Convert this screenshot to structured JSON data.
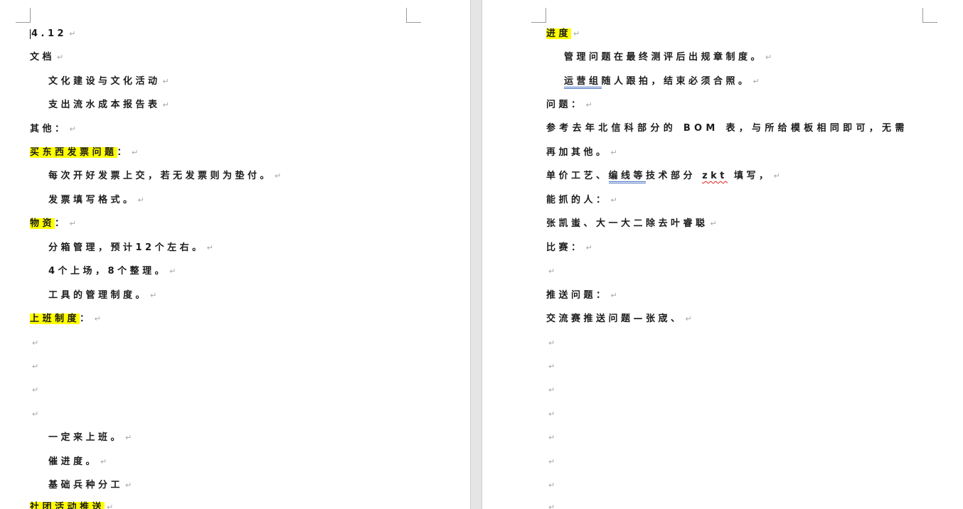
{
  "left_page": {
    "lines": [
      {
        "text": "4.12"
      },
      {
        "text": "文档"
      },
      {
        "text": "文化建设与文化活动"
      },
      {
        "text": "支出流水成本报告表"
      },
      {
        "text": "其他："
      },
      {
        "text": "买东西发票问题",
        "suffix": "："
      },
      {
        "text": "每次开好发票上交，若无发票则为垫付。"
      },
      {
        "text": "发票填写格式。"
      },
      {
        "text": "物资",
        "suffix": "："
      },
      {
        "text": "分箱管理，预计12个左右。"
      },
      {
        "text": "4个上场，8个整理。"
      },
      {
        "text": "工具的管理制度。"
      },
      {
        "text": "上班制度",
        "suffix": "："
      },
      {
        "text": ""
      },
      {
        "text": ""
      },
      {
        "text": ""
      },
      {
        "text": ""
      },
      {
        "text": "一定来上班。"
      },
      {
        "text": "催进度。"
      },
      {
        "text": "基础兵种分工"
      },
      {
        "text": "社团活动推送"
      }
    ]
  },
  "right_page": {
    "lines": [
      {
        "text": "进度"
      },
      {
        "text": "管理问题在最终测评后出规章制度。"
      },
      {
        "text": "运营组",
        "rest": "随人跟拍，结束必须合照。"
      },
      {
        "text": "问题："
      },
      {
        "text": "参考去年北信科部分的 BOM 表，与所给模板相同即可，无需"
      },
      {
        "text": "再加其他。"
      },
      {
        "pre": "单价工艺、",
        "text": "编线等",
        "mid": "技术部分",
        "wavy": "zkt",
        "rest": "填写，"
      },
      {
        "text": "能抓的人："
      },
      {
        "text": "张凯蚩、大一大二除去叶睿聪"
      },
      {
        "text": "比赛："
      },
      {
        "text": ""
      },
      {
        "text": "推送问题："
      },
      {
        "text": "交流赛推送问题—张宬、"
      },
      {
        "text": ""
      },
      {
        "text": ""
      },
      {
        "text": ""
      },
      {
        "text": ""
      },
      {
        "text": ""
      },
      {
        "text": ""
      },
      {
        "text": ""
      },
      {
        "text": ""
      }
    ]
  },
  "paragraph_mark": "↵"
}
